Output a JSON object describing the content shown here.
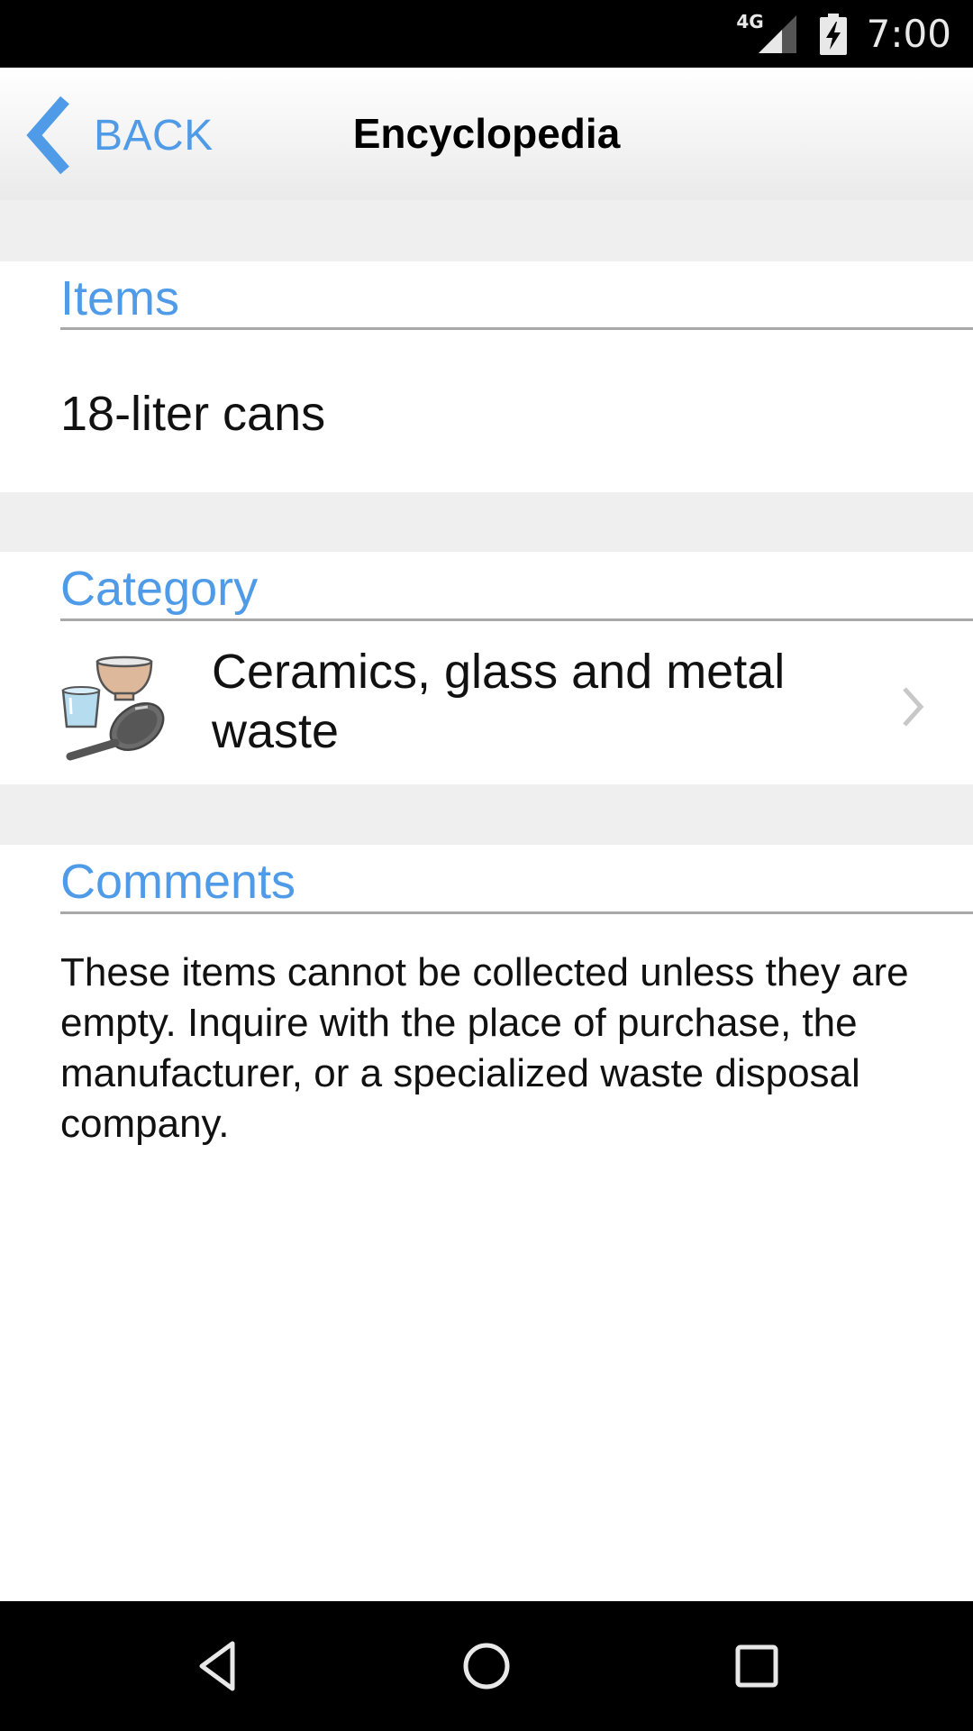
{
  "status_bar": {
    "network": "4G",
    "time": "7:00",
    "icons": [
      "signal-icon",
      "battery-charging-icon"
    ]
  },
  "header": {
    "back_label": "BACK",
    "title": "Encyclopedia",
    "back_icon": "chevron-left-icon"
  },
  "sections": {
    "items": {
      "title": "Items",
      "value": "18-liter cans"
    },
    "category": {
      "title": "Category",
      "label": "Ceramics, glass and metal waste",
      "icon": "ceramics-glass-metal-icon",
      "chevron": "chevron-right-icon"
    },
    "comments": {
      "title": "Comments",
      "text": "These items cannot be collected unless they are empty. Inquire with the place of purchase, the manufacturer, or a specialized waste disposal company."
    }
  },
  "nav_bar": {
    "buttons": [
      "back",
      "home",
      "recents"
    ]
  },
  "colors": {
    "accent": "#4f9be8",
    "divider": "#a8a8a8",
    "gap": "#efefef"
  }
}
